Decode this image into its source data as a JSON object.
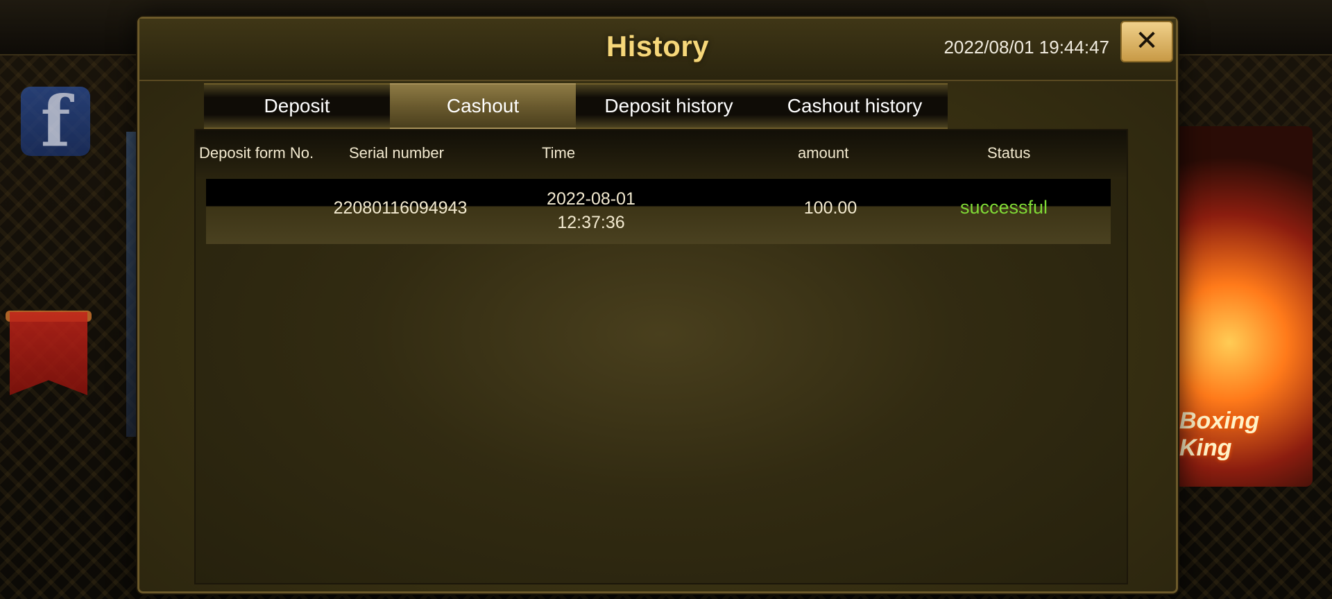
{
  "modal": {
    "title": "History",
    "datetime": "2022/08/01 19:44:47",
    "close_label": "✕"
  },
  "tabs": [
    {
      "label": "Deposit",
      "active": false
    },
    {
      "label": "Cashout",
      "active": true
    },
    {
      "label": "Deposit history",
      "active": false
    },
    {
      "label": "Cashout history",
      "active": false
    }
  ],
  "table": {
    "columns": [
      "Deposit form No.",
      "Serial number",
      "Time",
      "amount",
      "Status"
    ],
    "rows": [
      {
        "deposit_form_no": "",
        "serial_number": "22080116094943",
        "time_date": "2022-08-01",
        "time_clock": "12:37:36",
        "amount": "100.00",
        "status": "successful"
      }
    ]
  },
  "background": {
    "facebook_icon": "facebook-icon",
    "card_text": "Boxing King"
  },
  "colors": {
    "title_gold": "#f6d77a",
    "status_success": "#7fd936",
    "panel_brown": "#3b3313"
  }
}
